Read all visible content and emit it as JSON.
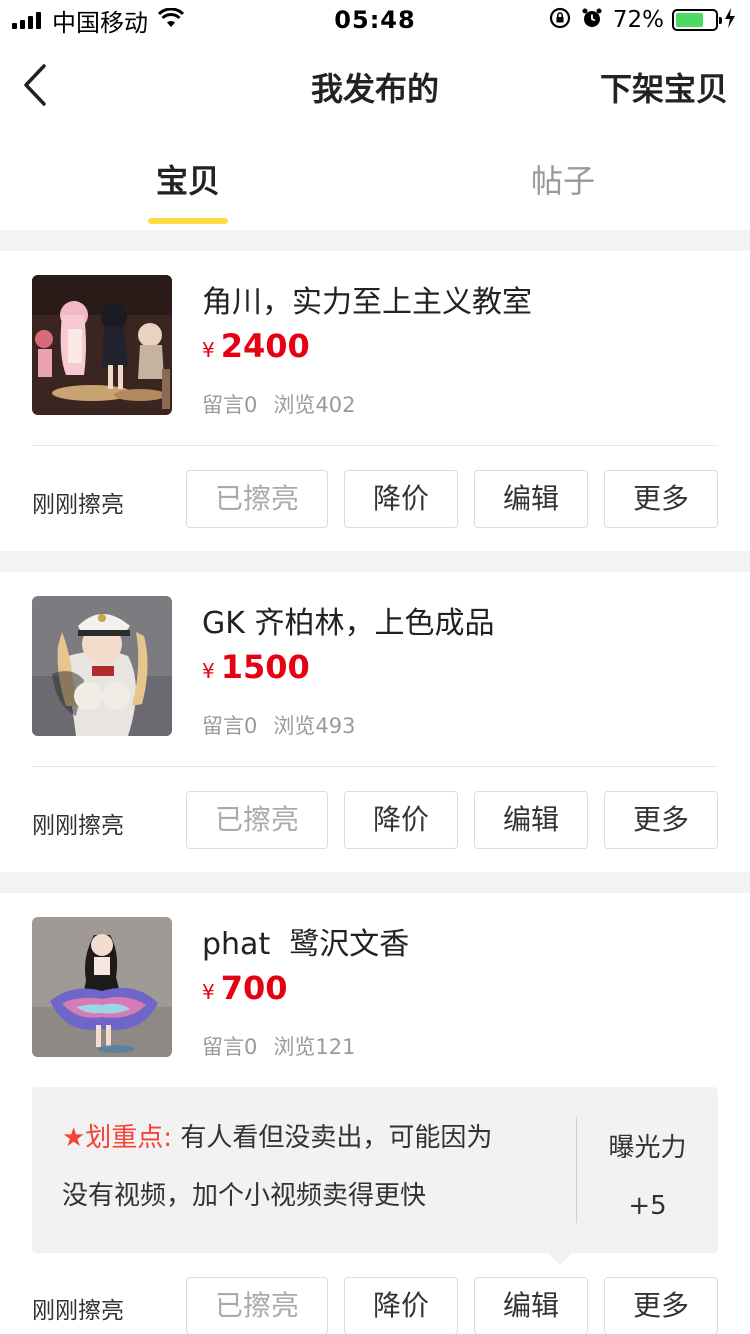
{
  "status_bar": {
    "carrier": "中国移动",
    "time": "05:48",
    "battery": "72%",
    "battery_level": 0.72
  },
  "nav": {
    "title": "我发布的",
    "action": "下架宝贝"
  },
  "tabs": [
    {
      "label": "宝贝",
      "active": true
    },
    {
      "label": "帖子",
      "active": false
    }
  ],
  "items": [
    {
      "title": "角川，实力至上主义教室",
      "currency": "¥",
      "price": "2400",
      "comments": "留言0",
      "views": "浏览402",
      "refresh_status": "刚刚擦亮",
      "buttons": [
        "已擦亮",
        "降价",
        "编辑",
        "更多"
      ]
    },
    {
      "title": "GK 齐柏林，上色成品",
      "currency": "¥",
      "price": "1500",
      "comments": "留言0",
      "views": "浏览493",
      "refresh_status": "刚刚擦亮",
      "buttons": [
        "已擦亮",
        "降价",
        "编辑",
        "更多"
      ]
    },
    {
      "title": "phat  鹭沢文香",
      "currency": "¥",
      "price": "700",
      "comments": "留言0",
      "views": "浏览121",
      "refresh_status": "刚刚擦亮",
      "buttons": [
        "已擦亮",
        "降价",
        "编辑",
        "更多"
      ],
      "tip": {
        "key": "★划重点:",
        "line1": "有人看但没卖出，可能因为",
        "line2": "没有视频，加个小视频卖得更快",
        "exposure_label": "曝光力",
        "exposure_value": "+5"
      }
    }
  ],
  "colors": {
    "accent": "#ffda44",
    "price": "#e60012",
    "tip_key": "#f44336",
    "battery": "#4cd964"
  }
}
